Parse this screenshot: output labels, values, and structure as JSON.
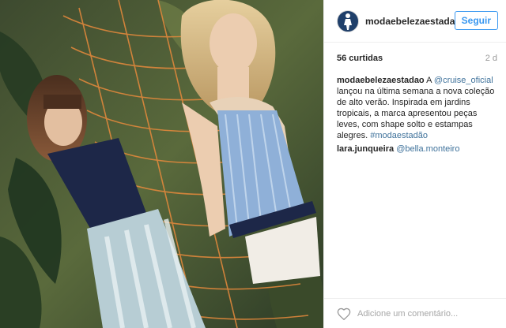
{
  "post": {
    "photo_icon": "fashion-photo",
    "username": "modaebelezaestadao",
    "follow_label": "Seguir",
    "likes": "56 curtidas",
    "time_ago": "2 d",
    "caption": {
      "user": "modaebelezaestadao",
      "text_1": " A ",
      "mention": "@cruise_oficial",
      "text_2": " lançou na última semana a nova coleção de alto verão. Inspirada em jardins tropicais, a marca apresentou peças leves, com shape solto e estampas alegres. ",
      "hashtag": "#modaestadão"
    },
    "comment": {
      "user": "lara.junqueira",
      "mention": "@bella.monteiro"
    },
    "comment_placeholder": "Adicione um comentário...",
    "colors": {
      "accent": "#3897f0",
      "link": "#3f729b",
      "avatar_bg": "#1f3f6a"
    }
  }
}
